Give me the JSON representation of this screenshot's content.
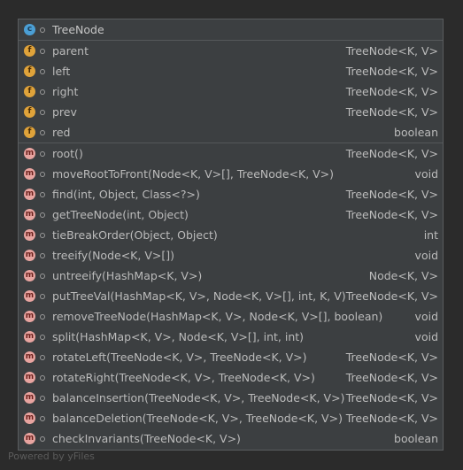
{
  "class": {
    "icon": "class-icon",
    "name": "TreeNode"
  },
  "fields": [
    {
      "name": "parent",
      "type": "TreeNode<K, V>"
    },
    {
      "name": "left",
      "type": "TreeNode<K, V>"
    },
    {
      "name": "right",
      "type": "TreeNode<K, V>"
    },
    {
      "name": "prev",
      "type": "TreeNode<K, V>"
    },
    {
      "name": "red",
      "type": "boolean"
    }
  ],
  "methods": [
    {
      "name": "root()",
      "type": "TreeNode<K, V>"
    },
    {
      "name": "moveRootToFront(Node<K, V>[], TreeNode<K, V>)",
      "type": "void"
    },
    {
      "name": "find(int, Object, Class<?>)",
      "type": "TreeNode<K, V>"
    },
    {
      "name": "getTreeNode(int, Object)",
      "type": "TreeNode<K, V>"
    },
    {
      "name": "tieBreakOrder(Object, Object)",
      "type": "int"
    },
    {
      "name": "treeify(Node<K, V>[])",
      "type": "void"
    },
    {
      "name": "untreeify(HashMap<K, V>)",
      "type": "Node<K, V>"
    },
    {
      "name": "putTreeVal(HashMap<K, V>, Node<K, V>[], int, K, V)",
      "type": "TreeNode<K, V>"
    },
    {
      "name": "removeTreeNode(HashMap<K, V>, Node<K, V>[], boolean)",
      "type": "void"
    },
    {
      "name": "split(HashMap<K, V>, Node<K, V>[], int, int)",
      "type": "void"
    },
    {
      "name": "rotateLeft(TreeNode<K, V>, TreeNode<K, V>)",
      "type": "TreeNode<K, V>"
    },
    {
      "name": "rotateRight(TreeNode<K, V>, TreeNode<K, V>)",
      "type": "TreeNode<K, V>"
    },
    {
      "name": "balanceInsertion(TreeNode<K, V>, TreeNode<K, V>)",
      "type": "TreeNode<K, V>"
    },
    {
      "name": "balanceDeletion(TreeNode<K, V>, TreeNode<K, V>)",
      "type": "TreeNode<K, V>"
    },
    {
      "name": "checkInvariants(TreeNode<K, V>)",
      "type": "boolean"
    }
  ],
  "icons": {
    "class_letter": "c",
    "field_letter": "f",
    "method_letter": "m"
  },
  "footer": "Powered by yFiles"
}
